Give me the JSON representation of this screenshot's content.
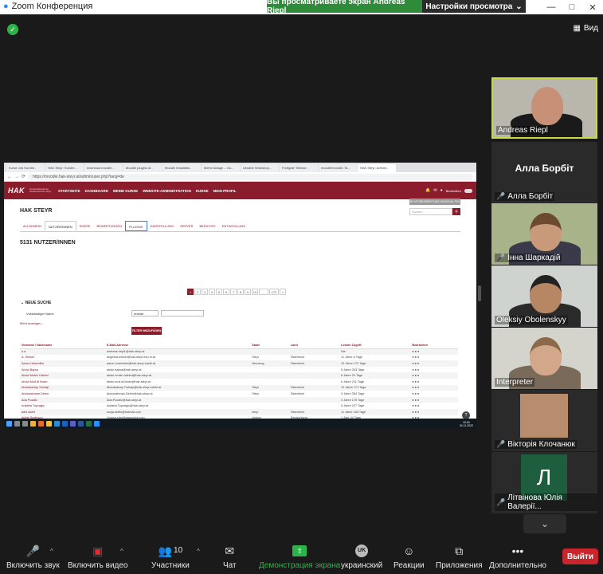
{
  "zoom": {
    "window_title": "Zoom Конференция",
    "share_banner": "Вы просматриваете экран Andreas Riepl",
    "view_options": "Настройки просмотра",
    "view_button": "Вид"
  },
  "browser": {
    "tabs": [
      "Kurse und Kursbe...",
      "HAK Steyr: Kursbe...",
      "download.moodle...",
      "Moodle plugins di...",
      "Moodle Installatio...",
      "Meine Ablage – Go...",
      "Ukraine Workshop...",
      "Fortigate Telewor...",
      "moodle/moodle: M...",
      "HAK Steyr: Admini..."
    ],
    "active_tab": 9,
    "url": "https://moodle.hak-steyr.at/admin/user.php?lang=de"
  },
  "moodle": {
    "logo": "HAK",
    "logo_sub": "Handelsakademie Handelsschule Steyr",
    "nav": [
      "STARTSEITE",
      "DASHBOARD",
      "MEINE KURSE",
      "WEBSITE-ADMINISTRATION",
      "KURSE",
      "MEIN PROFIL"
    ],
    "edit_mode": "Bearbeiten",
    "block_button": "BLOCKBEARBEITUNG EINSCHALTEN",
    "site_name": "HAK STEYR",
    "search_placeholder": "Suchen",
    "admin_tabs": [
      "ALLGEMEIN",
      "NUTZER/INNEN",
      "KURSE",
      "BEWERTUNGEN",
      "PLUGINS",
      "DARSTELLUNG",
      "SERVER",
      "BERICHTE",
      "ENTWICKLUNG"
    ],
    "selected_tab": 1,
    "highlighted_tab": 4,
    "users_count": "5131 NUTZER/INNEN",
    "pages": [
      "1",
      "2",
      "3",
      "4",
      "5",
      "6",
      "7",
      "8",
      "9",
      "10",
      "...",
      "172",
      "»"
    ],
    "filter_heading": "NEUE SUCHE",
    "filter_label": "Vollständiger Name",
    "filter_select": "enthält",
    "more_link": "Mehr anzeigen...",
    "filter_button": "FILTER HINZUFÜGEN",
    "table_headers": [
      "Vorname / Nachname",
      "E-Mail-Adresse",
      "Stadt",
      "Land",
      "Letzter Zugriff",
      "Bearbeiten"
    ],
    "rows": [
      [
        "a a",
        "andreas.riepl1@hak-steyr.at",
        "",
        "",
        "Nie"
      ],
      [
        "A. Wieser",
        "angelika.wieser@hak-steyr.edu.hi.at",
        "Steyr",
        "Österreich",
        "11 Jahre 8 Tage"
      ],
      [
        "Aaron Hoermiller",
        "aaron.hoermiller@hak-steyr.eduhi.at",
        "Neuzeug",
        "Österreich",
        "10 Jahre 172 Tage"
      ],
      [
        "Abdul Bajwa",
        "abdul.bajwa@hak-steyr.at",
        "",
        "",
        "5 Jahre 263 Tage"
      ],
      [
        "Abdul Mobin Hakimi",
        "abdul.mobin.hakimi@hak-steyr.at",
        "",
        "",
        "6 Jahre 20 Tage"
      ],
      [
        "Abdul Muit Al Ilman",
        "abdul.muit.al.ilman@hak-steyr.at",
        "",
        "",
        "6 Jahre 211 Tage"
      ],
      [
        "Abdulwahap Turkalp",
        "Abdulwahap.Turkalp@hak-steyr.eduhi.at",
        "Steyr",
        "Österreich",
        "12 Jahre 171 Tage"
      ],
      [
        "Abdurrahman Demir",
        "Abdurrahman.Demir@hak-steyr.at",
        "Steyr",
        "Österreich",
        "9 Jahre 354 Tage"
      ],
      [
        "Ada Pozalic",
        "Ada.Pozalic@hak-steyr.at",
        "",
        "",
        "3 Jahre 175 Tage"
      ],
      [
        "Adaleta Topvagic",
        "Adaleta.Topvagic@hak-steyr.at",
        "",
        "",
        "5 Jahre 227 Tage"
      ],
      [
        "adel.stuffz",
        "sonja.stuffz@hotmail.com",
        "steyr",
        "Österreich",
        "11 Jahre 160 Tage"
      ],
      [
        "Adele Smithson",
        "1sobss.sitm@wwpscha.com",
        "Antony",
        "Deutschland",
        "1 Jahr 44 Tage"
      ],
      [
        "Adeline Bijelog",
        "adeline_@hotmail.com",
        "Steyr",
        "Österreich",
        "11 Jahre 290 Tage"
      ],
      [
        "Adelina Begic",
        "Adelina.Begic@hak-steyr.at",
        "",
        "",
        "3 Jahre 175 Tage"
      ]
    ],
    "status_url": "moodle.hak-steyr.at/admin/..."
  },
  "taskbar": {
    "time": "10:54",
    "date": "24.11.2022"
  },
  "participants": [
    {
      "name": "Andreas Riepl",
      "muted": false
    },
    {
      "name": "Алла Борбіт",
      "muted": true
    },
    {
      "name": "Інна Шаркадій",
      "muted": true
    },
    {
      "name": "Oleksiy Obolenskyy",
      "muted": false
    },
    {
      "name": "Interpreter",
      "muted": false
    },
    {
      "name": "Вікторія Клочанюк",
      "muted": true
    },
    {
      "name": "Літвінова Юлія Валерії...",
      "muted": true
    }
  ],
  "avatar_letter": "Л",
  "toolbar": {
    "mute": "Включить звук",
    "video": "Включить видео",
    "participants": "Участники",
    "participants_count": "10",
    "chat": "Чат",
    "share": "Демонстрация экрана",
    "language_badge": "UK",
    "language": "украинский",
    "reactions": "Реакции",
    "apps": "Приложения",
    "more": "Дополнительно",
    "leave": "Выйти"
  },
  "colors": {
    "moodle_brand": "#8b1c2c",
    "zoom_green": "#2db34a",
    "leave_red": "#c9252d",
    "muted_red": "#e02b2b"
  }
}
